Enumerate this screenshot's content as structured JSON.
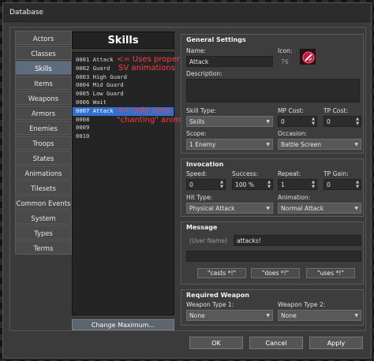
{
  "window": {
    "title": "Database"
  },
  "tabs": [
    "Actors",
    "Classes",
    "Skills",
    "Items",
    "Weapons",
    "Armors",
    "Enemies",
    "Troops",
    "States",
    "Animations",
    "Tilesets",
    "Common Events",
    "System",
    "Types",
    "Terms"
  ],
  "selected_tab": "Skills",
  "list": {
    "header": "Skills",
    "items": [
      "0001 Attack",
      "0002 Guard",
      "0003 High Guard",
      "0004 Mid Guard",
      "0005 Low Guard",
      "0006 Wait",
      "0007 Attack",
      "0008",
      "0009",
      "0010"
    ],
    "selected_index": 6,
    "change_button": "Change Maximum..."
  },
  "annotations": {
    "note1_line1": "<= Uses proper",
    "note1_line2": "SV animations",
    "note2_line1": "<= only uses",
    "note2_line2": "\"chanting\" animation"
  },
  "general": {
    "title": "General Settings",
    "name_label": "Name:",
    "name_value": "Attack",
    "icon_label": "Icon:",
    "icon_index": "76",
    "description_label": "Description:",
    "description_value": "",
    "skill_type_label": "Skill Type:",
    "skill_type_value": "Skills",
    "mp_cost_label": "MP Cost:",
    "mp_cost_value": "0",
    "tp_cost_label": "TP Cost:",
    "tp_cost_value": "0",
    "scope_label": "Scope:",
    "scope_value": "1 Enemy",
    "occasion_label": "Occasion:",
    "occasion_value": "Battle Screen"
  },
  "invocation": {
    "title": "Invocation",
    "speed_label": "Speed:",
    "speed_value": "0",
    "success_label": "Success:",
    "success_value": "100 %",
    "repeat_label": "Repeat:",
    "repeat_value": "1",
    "tp_gain_label": "TP Gain:",
    "tp_gain_value": "0",
    "hit_type_label": "Hit Type:",
    "hit_type_value": "Physical Attack",
    "animation_label": "Animation:",
    "animation_value": "Normal Attack"
  },
  "message": {
    "title": "Message",
    "user_name_placeholder": "(User Name)",
    "line1_value": "attacks!",
    "line2_value": "",
    "btn_casts": "\"casts *!\"",
    "btn_does": "\"does *!\"",
    "btn_uses": "\"uses *!\""
  },
  "required_weapon": {
    "title": "Required Weapon",
    "type1_label": "Weapon Type 1:",
    "type1_value": "None",
    "type2_label": "Weapon Type 2:",
    "type2_value": "None"
  },
  "buttons": {
    "ok": "OK",
    "cancel": "Cancel",
    "apply": "Apply"
  },
  "colors": {
    "selection": "#3170cf",
    "annotation": "#ff3d3d"
  }
}
